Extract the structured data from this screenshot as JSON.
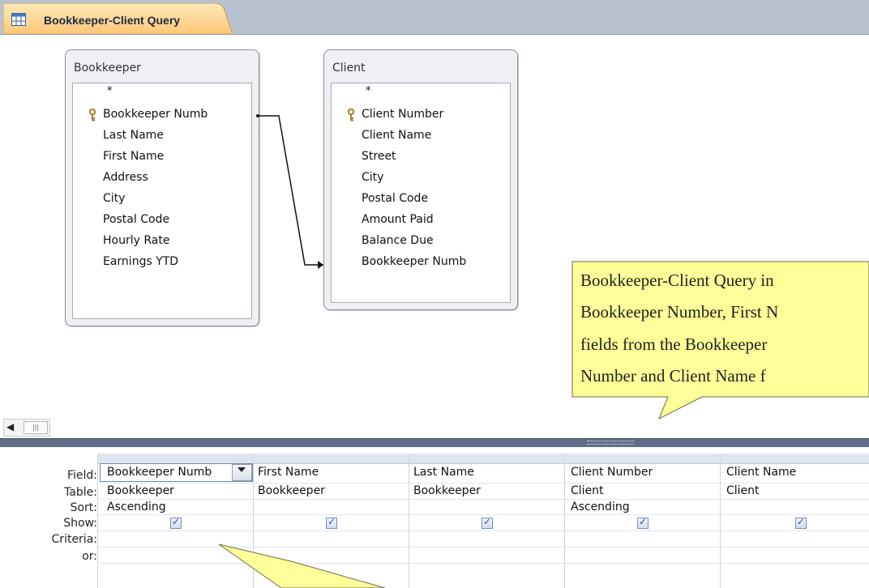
{
  "tab": {
    "title": "Bookkeeper-Client Query",
    "icon": "query-table-icon"
  },
  "tables": [
    {
      "name": "Bookkeeper",
      "fields": [
        "*",
        "Bookkeeper Numb",
        "Last Name",
        "First Name",
        "Address",
        "City",
        "Postal Code",
        "Hourly Rate",
        "Earnings YTD"
      ],
      "key_field": "Bookkeeper Numb"
    },
    {
      "name": "Client",
      "fields": [
        "*",
        "Client Number",
        "Client Name",
        "Street",
        "City",
        "Postal Code",
        "Amount Paid",
        "Balance Due",
        "Bookkeeper Numb"
      ],
      "key_field": "Client Number"
    }
  ],
  "callout": {
    "lines": [
      "Bookkeeper-Client Query in",
      "Bookkeeper Number, First N",
      "fields from the Bookkeeper",
      "Number and  Client Name f"
    ],
    "color": "#ffff99"
  },
  "grid": {
    "row_labels": [
      "Field:",
      "Table:",
      "Sort:",
      "Show:",
      "Criteria:",
      "or:"
    ],
    "columns": [
      {
        "field": "Bookkeeper Numb",
        "table": "Bookkeeper",
        "sort": "Ascending",
        "show": true
      },
      {
        "field": "First Name",
        "table": "Bookkeeper",
        "sort": "",
        "show": true
      },
      {
        "field": "Last Name",
        "table": "Bookkeeper",
        "sort": "",
        "show": true
      },
      {
        "field": "Client Number",
        "table": "Client",
        "sort": "Ascending",
        "show": true
      },
      {
        "field": "Client Name",
        "table": "Client",
        "sort": "",
        "show": true
      }
    ]
  },
  "scrollbar": {
    "left_arrow": "◀",
    "thumb": "|||"
  },
  "colors": {
    "tab_bg": "#ffd79a",
    "splitter": "#5f6e87",
    "callout": "#ffff99"
  }
}
